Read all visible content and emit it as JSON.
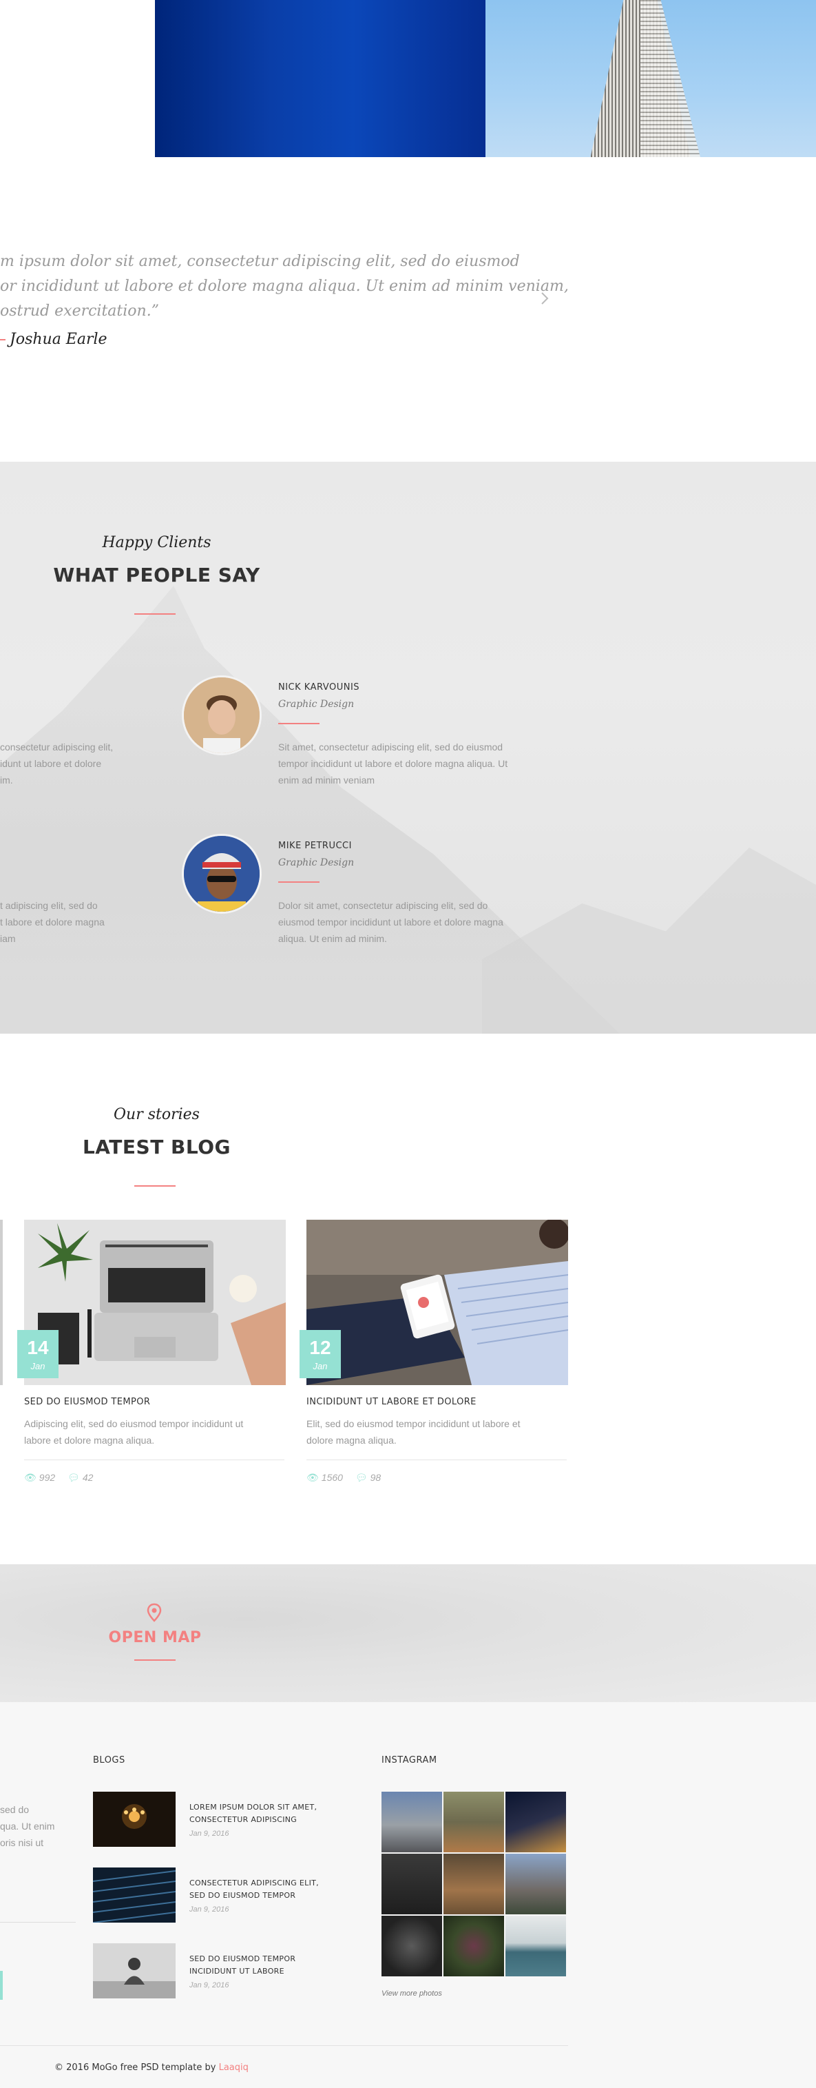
{
  "quote": {
    "lines": [
      "m ipsum dolor sit amet, consectetur adipiscing elit, sed do eiusmod",
      "or incididunt ut labore et dolore magna aliqua. Ut enim ad minim veniam,",
      "ostrud exercitation.”"
    ],
    "author": "Joshua Earle",
    "next_icon": "chevron-right-icon"
  },
  "testimonials": {
    "script_title": "Happy Clients",
    "title": "WHAT PEOPLE SAY",
    "left_partial": [
      [
        "consectetur adipiscing elit,",
        "idunt ut labore et dolore",
        "im."
      ],
      [
        "t adipiscing elit, sed do",
        "t labore et dolore magna",
        "iam"
      ]
    ],
    "items": [
      {
        "name": "NICK KARVOUNIS",
        "role": "Graphic Design",
        "text": [
          "Sit amet, consectetur adipiscing elit, sed do eiusmod",
          "tempor incididunt ut labore et dolore magna aliqua. Ut",
          "enim ad minim veniam"
        ]
      },
      {
        "name": "MIKE PETRUCCI",
        "role": "Graphic Design",
        "text": [
          "Dolor sit amet, consectetur adipiscing elit, sed do",
          "eiusmod tempor incididunt ut labore et dolore magna",
          "aliqua. Ut enim ad minim."
        ]
      }
    ]
  },
  "blog": {
    "script_title": "Our stories",
    "title": "LATEST BLOG",
    "posts": [
      {
        "day": "14",
        "month": "Jan",
        "title": "SED DO EIUSMOD TEMPOR",
        "excerpt": [
          "Adipiscing elit, sed do eiusmod tempor incididunt ut",
          "labore et dolore magna aliqua."
        ],
        "views": "992",
        "comments": "42"
      },
      {
        "day": "12",
        "month": "Jan",
        "title": "INCIDIDUNT UT LABORE ET DOLORE",
        "excerpt": [
          "Elit, sed do eiusmod tempor incididunt ut labore et",
          "dolore magna aliqua."
        ],
        "views": "1560",
        "comments": "98"
      }
    ]
  },
  "map": {
    "label": "OPEN MAP",
    "icon": "map-pin-icon"
  },
  "footer": {
    "left_partial": [
      "sed do",
      "qua. Ut enim",
      "oris nisi ut"
    ],
    "blogs_heading": "BLOGS",
    "blogs": [
      {
        "title": [
          "LOREM IPSUM DOLOR SIT AMET,",
          "CONSECTETUR ADIPISCING"
        ],
        "date": "Jan 9, 2016"
      },
      {
        "title": [
          "CONSECTETUR ADIPISCING ELIT,",
          "SED DO EIUSMOD TEMPOR"
        ],
        "date": "Jan 9, 2016"
      },
      {
        "title": [
          "SED DO EIUSMOD TEMPOR",
          "INCIDIDUNT UT LABORE"
        ],
        "date": "Jan 9, 2016"
      }
    ],
    "instagram_heading": "INSTAGRAM",
    "view_more": "View more photos",
    "copyright_prefix": "© 2016 MoGo free PSD template by",
    "copyright_link": "Laaqiq"
  },
  "colors": {
    "accent": "#f38181",
    "teal": "#95e1d3"
  }
}
